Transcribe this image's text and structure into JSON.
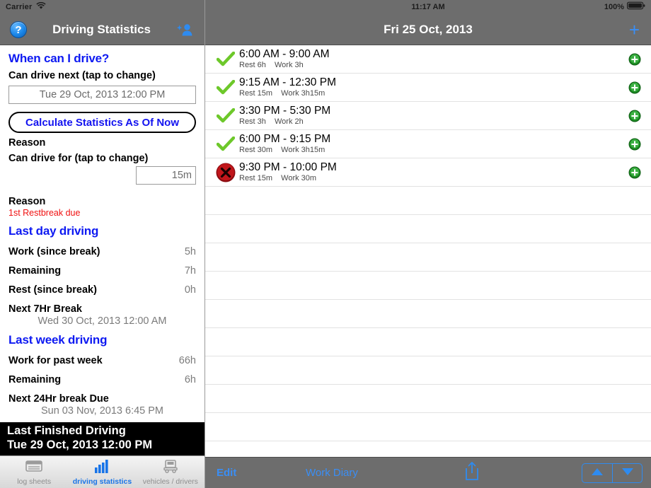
{
  "left": {
    "statusbar": {
      "carrier": "Carrier",
      "wifi_icon": "wifi-icon"
    },
    "navbar": {
      "help_icon": "question-mark-icon",
      "help_label": "?",
      "title": "Driving Statistics",
      "adduser_icon": "add-person-icon"
    },
    "sections": {
      "when_can_i_drive": "When can I drive?",
      "can_drive_next_label": "Can drive next (tap to change)",
      "can_drive_next_value": "Tue 29 Oct, 2013 12:00 PM",
      "calculate_button": "Calculate Statistics As Of Now",
      "reason_label_1": "Reason",
      "can_drive_for_label": "Can drive for (tap to change)",
      "can_drive_for_value": "15m",
      "reason_label_2": "Reason",
      "reason_value": "1st Restbreak due",
      "last_day_driving": "Last day driving",
      "last_week_driving": "Last week driving"
    },
    "last_day_stats": [
      {
        "key": "Work (since break)",
        "value": "5h"
      },
      {
        "key": "Remaining",
        "value": "7h"
      },
      {
        "key": "Rest (since break)",
        "value": "0h"
      }
    ],
    "next_7hr_break": {
      "key": "Next 7Hr Break",
      "value": "Wed 30 Oct, 2013 12:00 AM"
    },
    "last_week_stats": [
      {
        "key": "Work for past week",
        "value": "66h"
      },
      {
        "key": "Remaining",
        "value": "6h"
      }
    ],
    "next_24hr_break": {
      "key": "Next 24Hr break Due",
      "value": "Sun 03 Nov, 2013 6:45 PM"
    },
    "banner": {
      "line1": "Last Finished Driving",
      "line2": "Tue 29 Oct, 2013 12:00 PM"
    },
    "tabs": [
      {
        "label": "log sheets",
        "icon": "log-sheets-icon",
        "active": false
      },
      {
        "label": "driving statistics",
        "icon": "bar-chart-icon",
        "active": true
      },
      {
        "label": "vehicles / drivers",
        "icon": "truck-icon",
        "active": false
      }
    ]
  },
  "right": {
    "statusbar": {
      "time": "11:17 AM",
      "battery_pct": "100%",
      "battery_icon": "battery-full-icon"
    },
    "navbar": {
      "title": "Fri 25 Oct, 2013",
      "add_icon": "plus-icon"
    },
    "rows": [
      {
        "status": "ok",
        "time": "6:00 AM - 9:00 AM",
        "rest": "Rest 6h",
        "work": "Work 3h"
      },
      {
        "status": "ok",
        "time": "9:15 AM - 12:30 PM",
        "rest": "Rest 15m",
        "work": "Work 3h15m"
      },
      {
        "status": "ok",
        "time": "3:30 PM - 5:30 PM",
        "rest": "Rest 3h",
        "work": "Work 2h"
      },
      {
        "status": "ok",
        "time": "6:00 PM - 9:15 PM",
        "rest": "Rest 30m",
        "work": "Work 3h15m"
      },
      {
        "status": "fail",
        "time": "9:30 PM - 10:00 PM",
        "rest": "Rest 15m",
        "work": "Work 30m"
      }
    ],
    "empty_row_count": 10,
    "toolbar": {
      "edit_label": "Edit",
      "title_label": "Work Diary",
      "share_icon": "share-icon",
      "up_icon": "triangle-up-icon",
      "down_icon": "triangle-down-icon"
    }
  },
  "colors": {
    "accent_blue": "#0d19f2",
    "ios_blue": "#3a8ef5",
    "alert_red": "#f01010",
    "check_green": "#6dc82a",
    "fail_red": "#c0161b",
    "navbar_gray": "#6d6d6d"
  }
}
